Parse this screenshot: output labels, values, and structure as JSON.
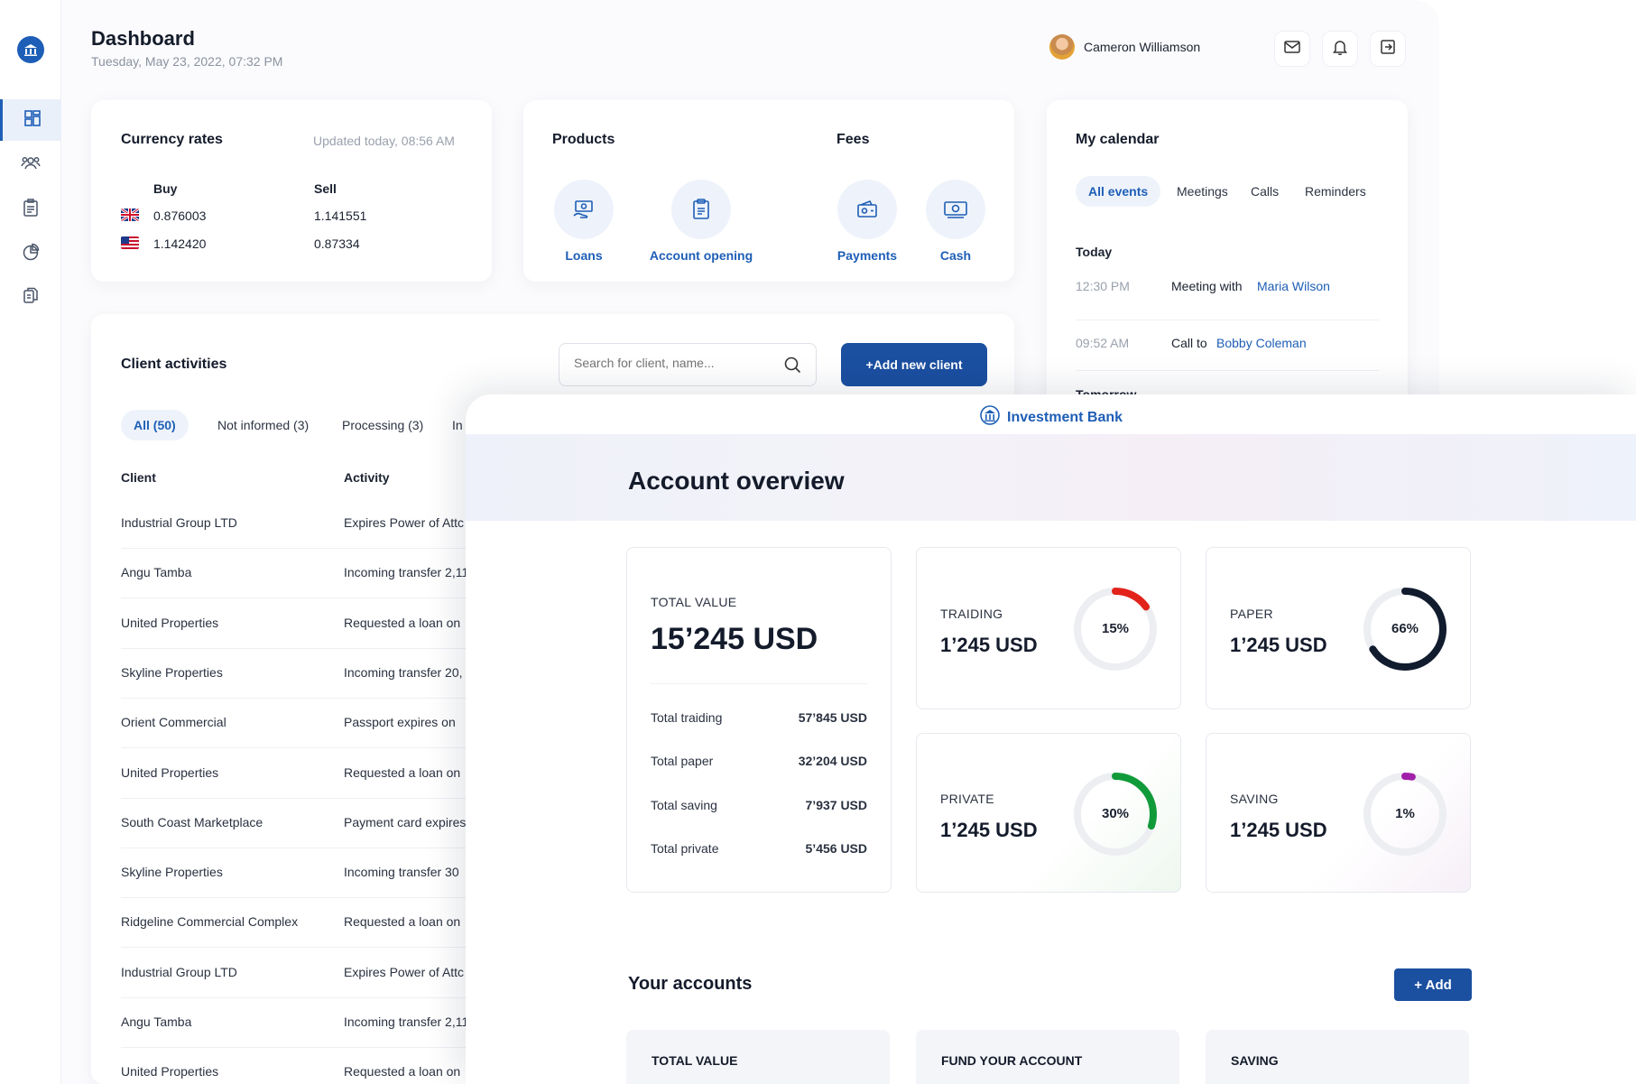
{
  "dashboard": {
    "title": "Dashboard",
    "date": "Tuesday, May 23, 2022, 07:32 PM",
    "user_name": "Cameron Williamson"
  },
  "currency": {
    "title": "Currency rates",
    "updated": "Updated today, 08:56 AM",
    "buy_label": "Buy",
    "sell_label": "Sell",
    "rows": [
      {
        "flag": "uk-flag-icon",
        "buy": "0.876003",
        "sell": "1.141551"
      },
      {
        "flag": "us-flag-icon",
        "buy": "1.142420",
        "sell": "0.87334"
      }
    ]
  },
  "products": {
    "title": "Products",
    "items": [
      {
        "label": "Loans",
        "icon": "loan-icon"
      },
      {
        "label": "Account opening",
        "icon": "document-icon"
      }
    ]
  },
  "fees": {
    "title": "Fees",
    "items": [
      {
        "label": "Payments",
        "icon": "payment-icon"
      },
      {
        "label": "Cash",
        "icon": "cash-icon"
      }
    ]
  },
  "calendar": {
    "title": "My calendar",
    "tabs": [
      "All events",
      "Meetings",
      "Calls",
      "Reminders"
    ],
    "today_label": "Today",
    "events": [
      {
        "time": "12:30 PM",
        "prefix": "Meeting with",
        "person": "Maria Wilson"
      },
      {
        "time": "09:52 AM",
        "prefix": "Call to",
        "person": "Bobby Coleman"
      }
    ],
    "tomorrow_label": "Tomorrow"
  },
  "clients": {
    "title": "Client activities",
    "search_placeholder": "Search for client, name...",
    "add_button": "+Add new client",
    "filters": [
      "All (50)",
      "Not informed (3)",
      "Processing (3)",
      "In"
    ],
    "col_client": "Client",
    "col_activity": "Activity",
    "rows": [
      {
        "client": "Industrial Group LTD",
        "activity": "Expires Power of Attc"
      },
      {
        "client": "Angu Tamba",
        "activity": "Incoming transfer 2,11"
      },
      {
        "client": "United Properties",
        "activity": "Requested a loan on"
      },
      {
        "client": "Skyline Properties",
        "activity": "Incoming transfer 20,"
      },
      {
        "client": "Orient Commercial",
        "activity": "Passport expires on"
      },
      {
        "client": "United Properties",
        "activity": "Requested a loan on"
      },
      {
        "client": "South Coast Marketplace",
        "activity": "Payment card expires"
      },
      {
        "client": "Skyline Properties",
        "activity": "Incoming transfer 30"
      },
      {
        "client": "Ridgeline Commercial Complex",
        "activity": "Requested a loan on"
      },
      {
        "client": "Industrial Group LTD",
        "activity": "Expires Power of Attc"
      },
      {
        "client": "Angu Tamba",
        "activity": "Incoming transfer 2,11"
      },
      {
        "client": "United Properties",
        "activity": "Requested a loan on"
      }
    ]
  },
  "overview": {
    "brand": "Investment Bank",
    "title": "Account overview",
    "total": {
      "label": "TOTAL VALUE",
      "value": "15’245 USD",
      "lines": [
        {
          "label": "Total traiding",
          "value": "57’845 USD"
        },
        {
          "label": "Total paper",
          "value": "32’204 USD"
        },
        {
          "label": "Total saving",
          "value": "7’937 USD"
        },
        {
          "label": "Total private",
          "value": "5’456 USD"
        }
      ]
    },
    "tiles": [
      {
        "label": "TRAIDING",
        "value": "1’245 USD",
        "percent_text": "15%",
        "percent": 15,
        "color": "#e2231a"
      },
      {
        "label": "PAPER",
        "value": "1’245 USD",
        "percent_text": "66%",
        "percent": 66,
        "color": "#111c2e"
      },
      {
        "label": "PRIVATE",
        "value": "1’245 USD",
        "percent_text": "30%",
        "percent": 30,
        "color": "#119a3a"
      },
      {
        "label": "SAVING",
        "value": "1’245 USD",
        "percent_text": "1%",
        "percent": 1,
        "color": "#a020a8"
      }
    ],
    "accounts_title": "Your accounts",
    "add_button": "+ Add",
    "account_cards": [
      "TOTAL VALUE",
      "FUND YOUR ACCOUNT",
      "SAVING"
    ]
  }
}
